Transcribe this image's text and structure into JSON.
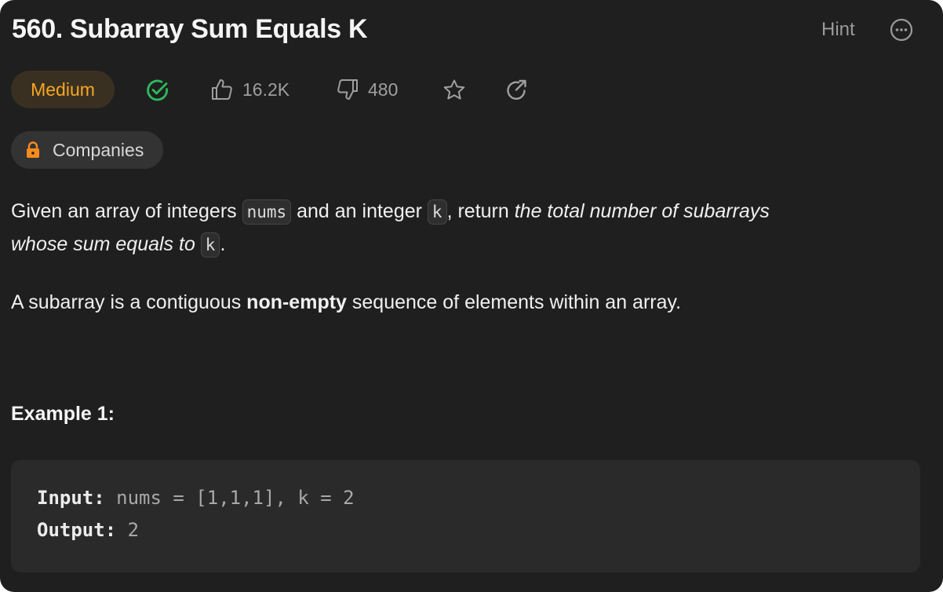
{
  "problem": {
    "title": "560. Subarray Sum Equals K",
    "hint_label": "Hint",
    "more_icon": "ellipsis-circle-icon"
  },
  "meta": {
    "difficulty": "Medium",
    "difficulty_color": "#f6a723",
    "solved_icon": "check-circle-icon",
    "solved_color": "#2cbb5d",
    "likes": "16.2K",
    "dislikes": "480",
    "favorite_icon": "star-icon",
    "share_icon": "share-icon"
  },
  "companies": {
    "label": "Companies",
    "icon": "lock-icon",
    "icon_color": "#f68b1f"
  },
  "description": {
    "p1_text1": "Given an array of integers ",
    "p1_code1": "nums",
    "p1_text2": " and an integer ",
    "p1_code2": "k",
    "p1_text3": ", return ",
    "p1_em1": "the total number of subarrays",
    "p1_em2": "whose sum equals to ",
    "p1_code3": "k",
    "p1_end": ".",
    "p2_text1": "A subarray is a contiguous ",
    "p2_bold": "non-empty",
    "p2_text2": " sequence of elements within an array."
  },
  "example1": {
    "title": "Example 1:",
    "input_label": "Input:",
    "input_value": " nums = [1,1,1], k = 2",
    "output_label": "Output:",
    "output_value": " 2"
  }
}
